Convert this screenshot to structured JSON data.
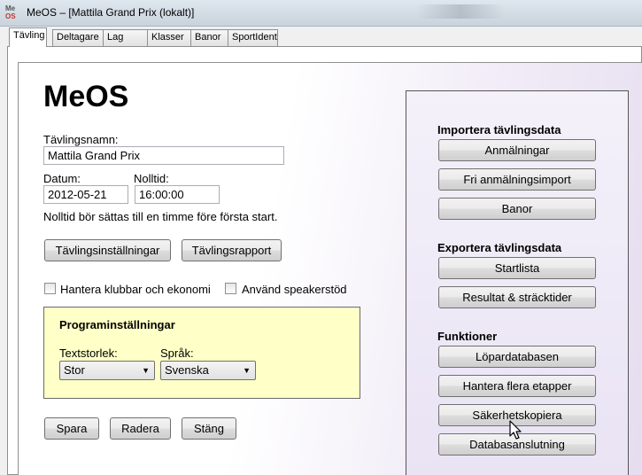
{
  "window": {
    "title": "MeOS – [Mattila Grand Prix (lokalt)]",
    "icon_top": "Me",
    "icon_bottom": "OS"
  },
  "tabs": [
    {
      "label": "Tävling",
      "active": true
    },
    {
      "label": "Deltagare"
    },
    {
      "label": "Lag"
    },
    {
      "label": "Klasser"
    },
    {
      "label": "Banor"
    },
    {
      "label": "SportIdent"
    }
  ],
  "competition": {
    "heading": "MeOS",
    "name_label": "Tävlingsnamn:",
    "name_value": "Mattila Grand Prix",
    "date_label": "Datum:",
    "date_value": "2012-05-21",
    "zero_label": "Nolltid:",
    "zero_value": "16:00:00",
    "zero_hint": "Nolltid bör sättas till en timme före första start.",
    "settings_button": "Tävlingsinställningar",
    "report_button": "Tävlingsrapport",
    "clubs_checkbox": "Hantera klubbar och ekonomi",
    "speaker_checkbox": "Använd speakerstöd"
  },
  "program": {
    "heading": "Programinställningar",
    "textsize_label": "Textstorlek:",
    "textsize_value": "Stor",
    "language_label": "Språk:",
    "language_value": "Svenska"
  },
  "actions": {
    "save": "Spara",
    "delete": "Radera",
    "close": "Stäng"
  },
  "import": {
    "heading": "Importera tävlingsdata",
    "entries": "Anmälningar",
    "free_import": "Fri anmälningsimport",
    "courses": "Banor"
  },
  "export": {
    "heading": "Exportera tävlingsdata",
    "startlist": "Startlista",
    "results": "Resultat & sträcktider"
  },
  "functions": {
    "heading": "Funktioner",
    "runner_db": "Löpardatabasen",
    "stages": "Hantera flera etapper",
    "backup": "Säkerhetskopiera",
    "db_connection": "Databasanslutning"
  }
}
